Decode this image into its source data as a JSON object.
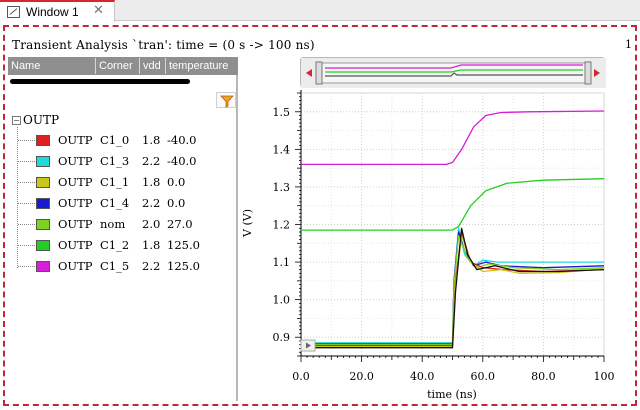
{
  "window": {
    "tab_label": "Window 1",
    "close_glyph": "✕"
  },
  "plot": {
    "title": "Transient Analysis `tran': time = (0 s -> 100 ns)",
    "index_label": "1"
  },
  "browser": {
    "columns": [
      "Name",
      "Corner",
      "vdd",
      "temperature"
    ],
    "root_label": "OUTP",
    "rows": [
      {
        "name": "OUTP",
        "corner": "C1_0",
        "vdd": "1.8",
        "temperature": "-40.0",
        "color": "#e0201e"
      },
      {
        "name": "OUTP",
        "corner": "C1_3",
        "vdd": "2.2",
        "temperature": "-40.0",
        "color": "#1fdadc"
      },
      {
        "name": "OUTP",
        "corner": "C1_1",
        "vdd": "1.8",
        "temperature": "0.0",
        "color": "#c8c81a"
      },
      {
        "name": "OUTP",
        "corner": "C1_4",
        "vdd": "2.2",
        "temperature": "0.0",
        "color": "#1a1ad2"
      },
      {
        "name": "OUTP",
        "corner": "nom",
        "vdd": "2.0",
        "temperature": "27.0",
        "color": "#7ed321"
      },
      {
        "name": "OUTP",
        "corner": "C1_2",
        "vdd": "1.8",
        "temperature": "125.0",
        "color": "#20d020"
      },
      {
        "name": "OUTP",
        "corner": "C1_5",
        "vdd": "2.2",
        "temperature": "125.0",
        "color": "#d61ed6"
      }
    ]
  },
  "chart_data": {
    "type": "line",
    "xlabel": "time (ns)",
    "ylabel": "V (V)",
    "xlim": [
      0,
      100
    ],
    "ylim": [
      0.85,
      1.55
    ],
    "x_ticks": [
      "0.0",
      "20.0",
      "40.0",
      "60.0",
      "80.0",
      "100"
    ],
    "y_ticks": [
      "0.9",
      "1.0",
      "1.1",
      "1.2",
      "1.3",
      "1.4",
      "1.5"
    ],
    "grid": true,
    "series": [
      {
        "color": "#d61ed6",
        "points": [
          [
            0,
            1.36
          ],
          [
            48,
            1.36
          ],
          [
            50,
            1.365
          ],
          [
            53,
            1.4
          ],
          [
            57,
            1.46
          ],
          [
            61,
            1.49
          ],
          [
            66,
            1.498
          ],
          [
            75,
            1.5
          ],
          [
            100,
            1.502
          ]
        ]
      },
      {
        "color": "#20d020",
        "points": [
          [
            0,
            1.185
          ],
          [
            50,
            1.185
          ],
          [
            52,
            1.195
          ],
          [
            56,
            1.25
          ],
          [
            61,
            1.29
          ],
          [
            68,
            1.31
          ],
          [
            80,
            1.318
          ],
          [
            100,
            1.322
          ]
        ]
      },
      {
        "color": "#1fdadc",
        "points": [
          [
            0,
            0.885
          ],
          [
            50,
            0.885
          ],
          [
            50.5,
            1.05
          ],
          [
            52,
            1.19
          ],
          [
            54,
            1.12
          ],
          [
            57,
            1.09
          ],
          [
            60,
            1.105
          ],
          [
            65,
            1.1
          ],
          [
            75,
            1.1
          ],
          [
            100,
            1.1
          ]
        ]
      },
      {
        "color": "#1a1ad2",
        "points": [
          [
            0,
            0.882
          ],
          [
            50,
            0.882
          ],
          [
            50.5,
            1.05
          ],
          [
            52,
            1.18
          ],
          [
            54,
            1.13
          ],
          [
            57,
            1.09
          ],
          [
            61,
            1.1
          ],
          [
            66,
            1.09
          ],
          [
            80,
            1.085
          ],
          [
            100,
            1.09
          ]
        ]
      },
      {
        "color": "#7ed321",
        "points": [
          [
            0,
            0.88
          ],
          [
            50,
            0.88
          ],
          [
            50.5,
            1.04
          ],
          [
            52,
            1.17
          ],
          [
            55,
            1.11
          ],
          [
            58,
            1.085
          ],
          [
            62,
            1.095
          ],
          [
            70,
            1.085
          ],
          [
            85,
            1.08
          ],
          [
            100,
            1.085
          ]
        ]
      },
      {
        "color": "#e0201e",
        "points": [
          [
            0,
            0.878
          ],
          [
            50,
            0.878
          ],
          [
            51,
            1.05
          ],
          [
            53,
            1.18
          ],
          [
            56,
            1.1
          ],
          [
            60,
            1.085
          ],
          [
            67,
            1.08
          ],
          [
            80,
            1.075
          ],
          [
            100,
            1.08
          ]
        ]
      },
      {
        "color": "#c8c81a",
        "points": [
          [
            0,
            0.875
          ],
          [
            50,
            0.875
          ],
          [
            51,
            1.04
          ],
          [
            53,
            1.17
          ],
          [
            56,
            1.1
          ],
          [
            60,
            1.075
          ],
          [
            66,
            1.08
          ],
          [
            72,
            1.07
          ],
          [
            85,
            1.072
          ],
          [
            100,
            1.082
          ]
        ]
      },
      {
        "color": "#111111",
        "points": [
          [
            0,
            0.872
          ],
          [
            50,
            0.872
          ],
          [
            51,
            1.02
          ],
          [
            53,
            1.19
          ],
          [
            55,
            1.12
          ],
          [
            58,
            1.08
          ],
          [
            64,
            1.09
          ],
          [
            72,
            1.075
          ],
          [
            85,
            1.075
          ],
          [
            100,
            1.08
          ]
        ]
      }
    ]
  }
}
